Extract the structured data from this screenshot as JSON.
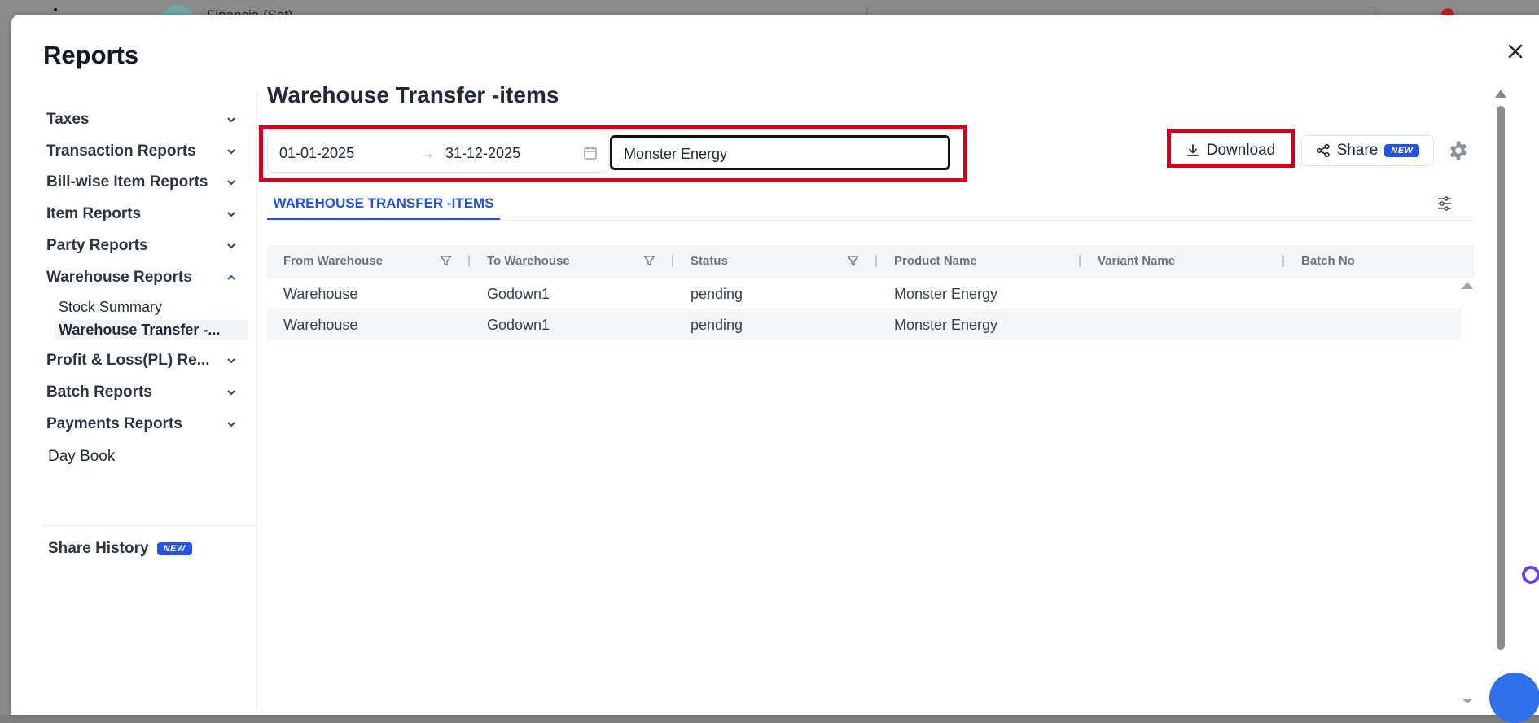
{
  "background": {
    "app_title": "Financia (Sat)"
  },
  "modal": {
    "title": "Reports"
  },
  "sidebar": {
    "items": [
      {
        "label": "Taxes"
      },
      {
        "label": "Transaction Reports"
      },
      {
        "label": "Bill-wise Item Reports"
      },
      {
        "label": "Item Reports"
      },
      {
        "label": "Party Reports"
      },
      {
        "label": "Warehouse Reports"
      },
      {
        "label": "Profit & Loss(PL) Re..."
      },
      {
        "label": "Batch Reports"
      },
      {
        "label": "Payments Reports"
      }
    ],
    "warehouse_sub": [
      {
        "label": "Stock Summary"
      },
      {
        "label": "Warehouse Transfer -..."
      }
    ],
    "day_book": "Day Book",
    "share_history": "Share History",
    "new_badge": "NEW"
  },
  "main": {
    "title": "Warehouse Transfer -items",
    "date_start": "01-01-2025",
    "date_arrow": "→",
    "date_end": "31-12-2025",
    "search_value": "Monster Energy",
    "download_label": "Download",
    "share_label": "Share",
    "share_badge": "NEW",
    "tab_label": "WAREHOUSE TRANSFER -ITEMS",
    "accent_color": "#2453e0",
    "highlight_color": "#d0021b"
  },
  "table": {
    "columns": [
      "From Warehouse",
      "To Warehouse",
      "Status",
      "Product Name",
      "Variant Name",
      "Batch No"
    ],
    "rows": [
      [
        "Warehouse",
        "Godown1",
        "pending",
        "Monster Energy",
        "",
        ""
      ],
      [
        "Warehouse",
        "Godown1",
        "pending",
        "Monster Energy",
        "",
        ""
      ]
    ]
  }
}
